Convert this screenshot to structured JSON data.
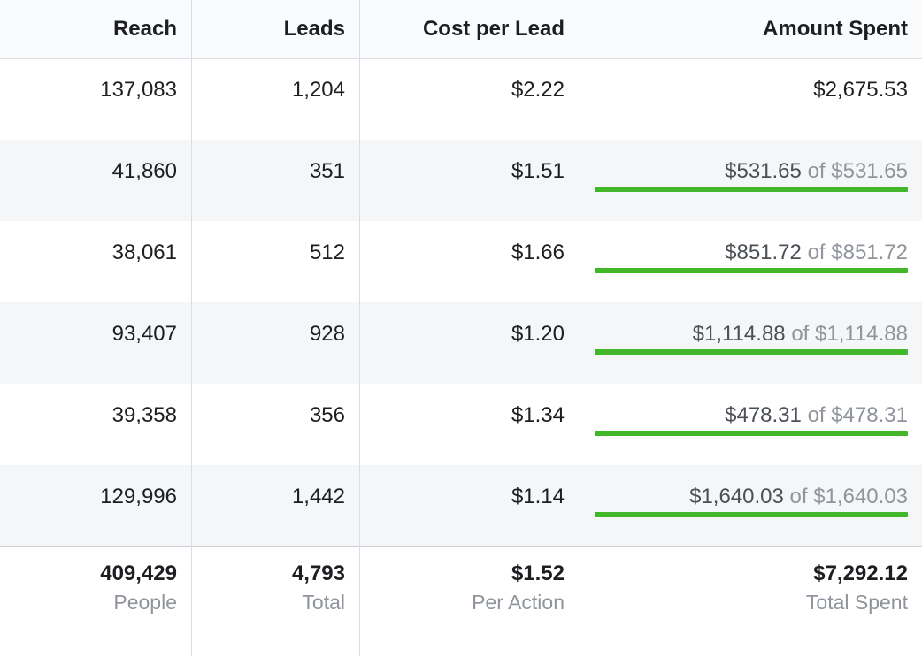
{
  "columns": {
    "reach": "Reach",
    "leads": "Leads",
    "cost_per_lead": "Cost per Lead",
    "amount_spent": "Amount Spent"
  },
  "rows": [
    {
      "reach": "137,083",
      "leads": "1,204",
      "cost_per_lead": "$2.22",
      "amount": "$2,675.53",
      "of_text": "",
      "progress": null
    },
    {
      "reach": "41,860",
      "leads": "351",
      "cost_per_lead": "$1.51",
      "amount": "$531.65",
      "of_text": "of $531.65",
      "progress": 1.0
    },
    {
      "reach": "38,061",
      "leads": "512",
      "cost_per_lead": "$1.66",
      "amount": "$851.72",
      "of_text": "of $851.72",
      "progress": 1.0
    },
    {
      "reach": "93,407",
      "leads": "928",
      "cost_per_lead": "$1.20",
      "amount": "$1,114.88",
      "of_text": "of $1,114.88",
      "progress": 1.0
    },
    {
      "reach": "39,358",
      "leads": "356",
      "cost_per_lead": "$1.34",
      "amount": "$478.31",
      "of_text": "of $478.31",
      "progress": 1.0
    },
    {
      "reach": "129,996",
      "leads": "1,442",
      "cost_per_lead": "$1.14",
      "amount": "$1,640.03",
      "of_text": "of $1,640.03",
      "progress": 1.0
    }
  ],
  "totals": {
    "reach": {
      "value": "409,429",
      "label": "People"
    },
    "leads": {
      "value": "4,793",
      "label": "Total"
    },
    "cost_per_lead": {
      "value": "$1.52",
      "label": "Per Action"
    },
    "amount_spent": {
      "value": "$7,292.12",
      "label": "Total Spent"
    }
  },
  "colors": {
    "progress_fill": "#42b72a",
    "alt_row_bg": "#f5f6f7",
    "muted_text": "#90949c"
  }
}
